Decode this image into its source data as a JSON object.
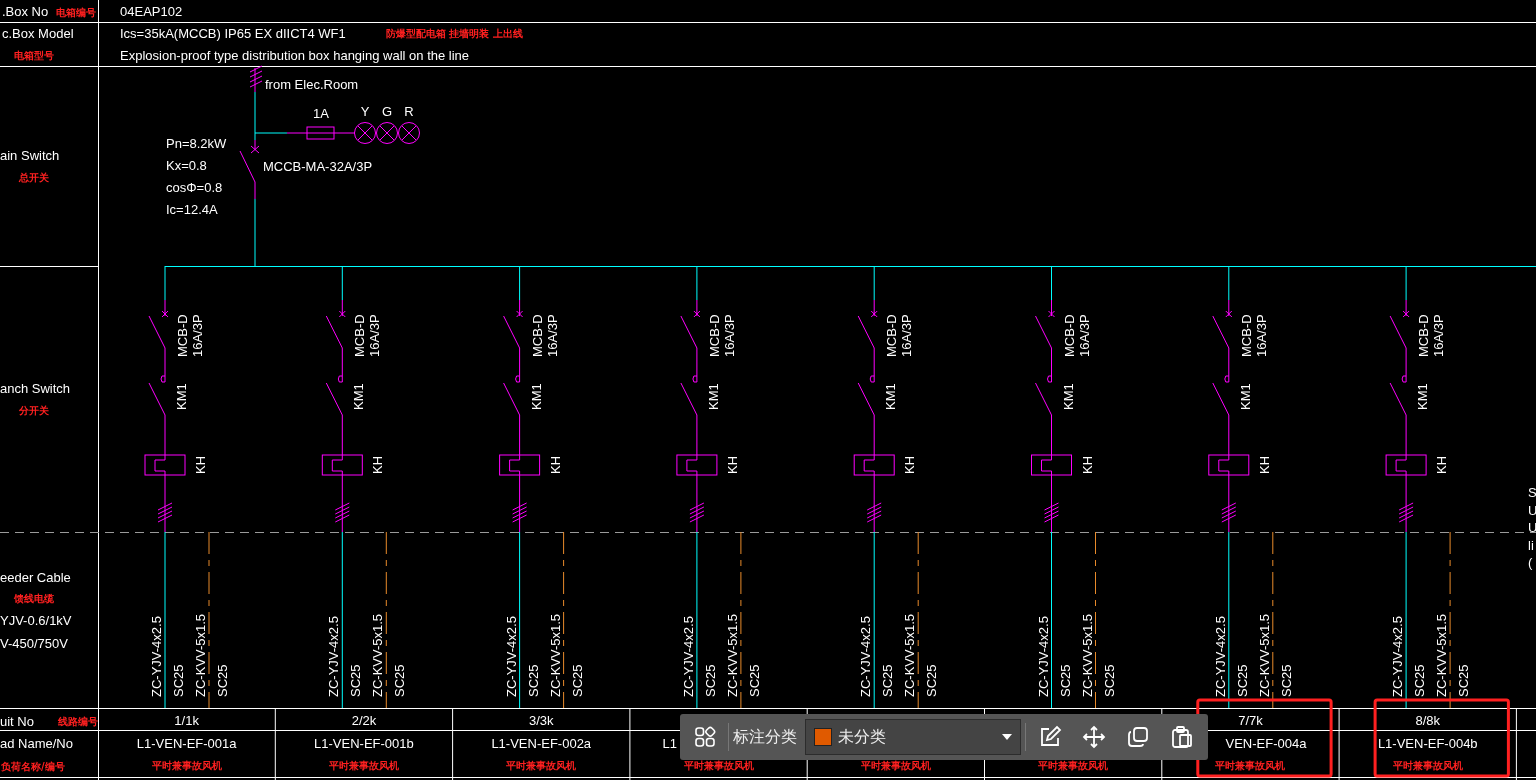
{
  "header": {
    "box_no_label": ".Box No",
    "box_no_label_cn": "电箱编号",
    "box_no": "04EAP102",
    "model_label": "c.Box Model",
    "model_label_cn": "电箱型号",
    "model_spec": "Ics=35kA(MCCB) IP65 EX dIICT4 WF1",
    "model_spec_cn": "防爆型配电箱 挂墙明装 上出线",
    "model_desc": "Explosion-proof type distribution box hanging wall on the line"
  },
  "row_labels": {
    "main_switch": "ain Switch",
    "main_switch_cn": "总开关",
    "branch_switch": "anch Switch",
    "branch_switch_cn": "分开关",
    "feeder_cable": "eeder Cable",
    "feeder_cable_cn": "馈线电缆",
    "feeder_spec_1": "YJV-0.6/1kV",
    "feeder_spec_2": "V-450/750V",
    "circuit_no": "uit No",
    "circuit_no_cn": "线路编号",
    "load_name": "ad Name/No",
    "load_name_cn": "负荷名称/编号"
  },
  "main": {
    "source": "from Elec.Room",
    "fuse": "1A",
    "lamps": [
      "Y",
      "G",
      "R"
    ],
    "params": [
      "Pn=8.2kW",
      "Kx=0.8",
      "cosΦ=0.8",
      "Ic=12.4A"
    ],
    "breaker": "MCCB-MA-32A/3P"
  },
  "circuits": [
    {
      "breaker": "MCB-D",
      "rating": "16A/3P",
      "contactor": "KM1",
      "relay": "KH",
      "power_cable": "ZC-YJV-4x2.5",
      "power_conduit": "SC25",
      "control_cable": "ZC-KVV-5x1.5",
      "control_conduit": "SC25",
      "circuit_no": "1/1k",
      "load_no": "L1-VEN-EF-001a",
      "load_name": "平时兼事故风机",
      "highlighted": false
    },
    {
      "breaker": "MCB-D",
      "rating": "16A/3P",
      "contactor": "KM1",
      "relay": "KH",
      "power_cable": "ZC-YJV-4x2.5",
      "power_conduit": "SC25",
      "control_cable": "ZC-KVV-5x1.5",
      "control_conduit": "SC25",
      "circuit_no": "2/2k",
      "load_no": "L1-VEN-EF-001b",
      "load_name": "平时兼事故风机",
      "highlighted": false
    },
    {
      "breaker": "MCB-D",
      "rating": "16A/3P",
      "contactor": "KM1",
      "relay": "KH",
      "power_cable": "ZC-YJV-4x2.5",
      "power_conduit": "SC25",
      "control_cable": "ZC-KVV-5x1.5",
      "control_conduit": "SC25",
      "circuit_no": "3/3k",
      "load_no": "L1-VEN-EF-002a",
      "load_name": "平时兼事故风机",
      "highlighted": false
    },
    {
      "breaker": "MCB-D",
      "rating": "16A/3P",
      "contactor": "KM1",
      "relay": "KH",
      "power_cable": "ZC-YJV-4x2.5",
      "power_conduit": "SC25",
      "control_cable": "ZC-KVV-5x1.5",
      "control_conduit": "SC25",
      "load_no": "L1",
      "load_name": "平时兼事故风机",
      "highlighted": false
    },
    {
      "breaker": "MCB-D",
      "rating": "16A/3P",
      "contactor": "KM1",
      "relay": "KH",
      "power_cable": "ZC-YJV-4x2.5",
      "power_conduit": "SC25",
      "control_cable": "ZC-KVV-5x1.5",
      "control_conduit": "SC25",
      "load_name": "平时兼事故风机",
      "highlighted": false
    },
    {
      "breaker": "MCB-D",
      "rating": "16A/3P",
      "contactor": "KM1",
      "relay": "KH",
      "power_cable": "ZC-YJV-4x2.5",
      "power_conduit": "SC25",
      "control_cable": "ZC-KVV-5x1.5",
      "control_conduit": "SC25",
      "load_name": "平时兼事故风机",
      "highlighted": false
    },
    {
      "breaker": "MCB-D",
      "rating": "16A/3P",
      "contactor": "KM1",
      "relay": "KH",
      "power_cable": "ZC-YJV-4x2.5",
      "power_conduit": "SC25",
      "control_cable": "ZC-KVV-5x1.5",
      "control_conduit": "SC25",
      "circuit_no": "7/7k",
      "load_no": "VEN-EF-004a",
      "load_name": "平时兼事故风机",
      "highlighted": true
    },
    {
      "breaker": "MCB-D",
      "rating": "16A/3P",
      "contactor": "KM1",
      "relay": "KH",
      "power_cable": "ZC-YJV-4x2.5",
      "power_conduit": "SC25",
      "control_cable": "ZC-KVV-5x1.5",
      "control_conduit": "SC25",
      "circuit_no": "8/8k",
      "load_no": "L1-VEN-EF-004b",
      "load_name": "平时兼事故风机",
      "highlighted": true
    }
  ],
  "edge_note": [
    "S",
    "U",
    "U",
    "li",
    "("
  ],
  "toolbar": {
    "label": "标注分类",
    "category": {
      "value": "未分类",
      "color": "#e05a00"
    }
  }
}
